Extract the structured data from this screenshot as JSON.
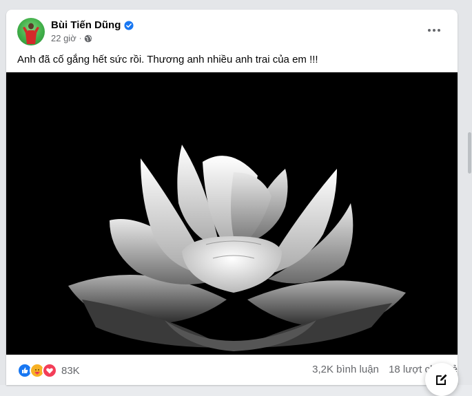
{
  "post": {
    "author": "Bùi Tiến Dũng",
    "time": "22 giờ",
    "separator": "·",
    "caption": "Anh đã cố gắng hết sức rồi. Thương anh nhiều anh trai của em !!!",
    "photo_subject": "white-lotus-flower",
    "reactions": {
      "icons": [
        "like-icon",
        "care-icon",
        "love-icon"
      ],
      "count": "83K"
    },
    "comments": "3,2K bình luận",
    "shares": "18 lượt chia sẻ"
  },
  "colors": {
    "verified": "#1877f2",
    "like": "#1877f2",
    "care": "#f7b125",
    "love": "#f33e58",
    "muted_text": "#65676b"
  }
}
